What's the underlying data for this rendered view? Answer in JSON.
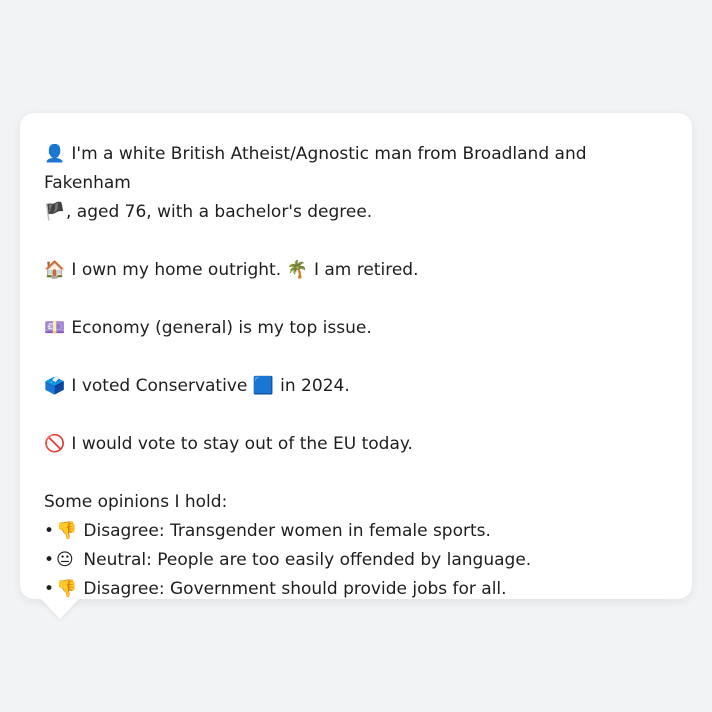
{
  "profile": {
    "line1": {
      "icon": "👤",
      "text_a": "I'm a white British Atheist/Agnostic man from Broadland and Fakenham",
      "flag": "🏴",
      "text_b": ", aged 76, with a bachelor's degree."
    },
    "line2": {
      "icon_home": "🏠",
      "text_home": "I own my home outright.",
      "icon_palm": "🌴",
      "text_retired": "I am retired."
    },
    "line3": {
      "icon": "💷",
      "text": "Economy (general) is my top issue."
    },
    "line4": {
      "icon": "🗳️",
      "text_a": "I voted Conservative",
      "square": "🟦",
      "text_b": "in 2024."
    },
    "line5": {
      "icon": "🚫",
      "text": "I would vote to stay out of the EU today."
    },
    "opinions": {
      "heading": "Some opinions I hold:",
      "bullet": "•",
      "items": [
        {
          "icon": "👎",
          "text": "Disagree: Transgender women in female sports."
        },
        {
          "icon": "😐",
          "text": "Neutral: People are too easily offended by language."
        },
        {
          "icon": "👎",
          "text": "Disagree: Government should provide jobs for all."
        }
      ]
    }
  }
}
